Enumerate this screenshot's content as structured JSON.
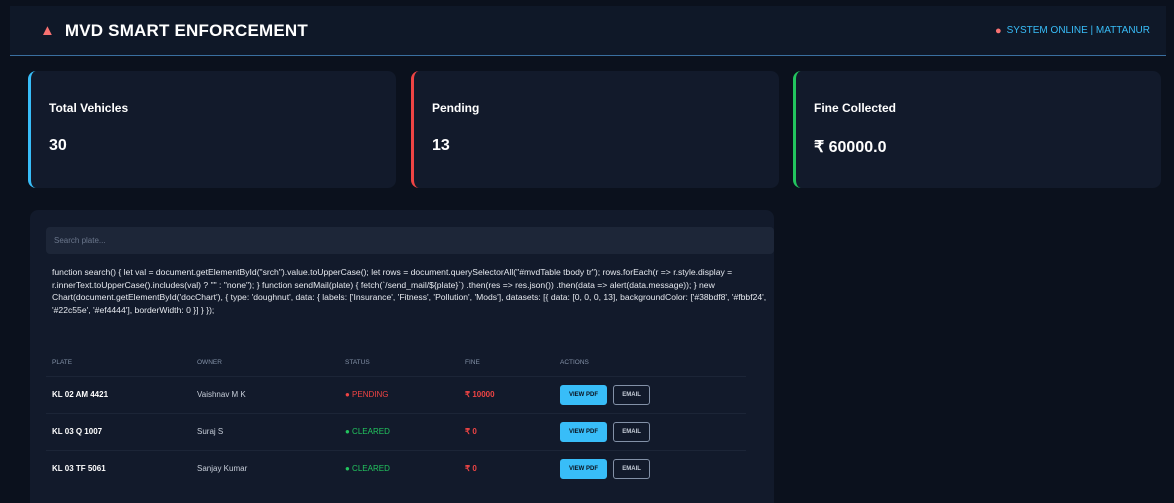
{
  "header": {
    "icon": "siren-icon",
    "title": "MVD SMART ENFORCEMENT",
    "status_icon": "pin-icon",
    "status_text": "SYSTEM ONLINE | MATTANUR"
  },
  "cards": [
    {
      "label": "Total Vehicles",
      "value": "30",
      "accent": "#38bdf8"
    },
    {
      "label": "Pending",
      "value": "13",
      "accent": "#ef4444"
    },
    {
      "label": "Fine Collected",
      "value": "₹ 60000.0",
      "accent": "#22c55e"
    }
  ],
  "search": {
    "placeholder": "Search plate..."
  },
  "script_text": "function search() { let val = document.getElementById(\"srch\").value.toUpperCase(); let rows = document.querySelectorAll(\"#mvdTable tbody tr\"); rows.forEach(r => r.style.display = r.innerText.toUpperCase().includes(val) ? \"\" : \"none\"); } function sendMail(plate) { fetch(`/send_mail/${plate}`) .then(res => res.json()) .then(data => alert(data.message)); } new Chart(document.getElementById('docChart'), { type: 'doughnut', data: { labels: ['Insurance', 'Fitness', 'Pollution', 'Mods'], datasets: [{ data: [0, 0, 0, 13], backgroundColor: ['#38bdf8', '#fbbf24', '#22c55e', '#ef4444'], borderWidth: 0 }] } });",
  "table": {
    "headers": {
      "plate": "PLATE",
      "owner": "OWNER",
      "status": "STATUS",
      "fine": "FINE",
      "actions": "ACTIONS"
    },
    "rows": [
      {
        "plate": "KL 02 AM 4421",
        "owner": "Vaishnav M K",
        "status": "● PENDING",
        "fine": "₹ 10000"
      },
      {
        "plate": "KL 03 Q 1007",
        "owner": "Suraj S",
        "status": "● CLEARED",
        "fine": "₹ 0"
      },
      {
        "plate": "KL 03 TF 5061",
        "owner": "Sanjay Kumar",
        "status": "● CLEARED",
        "fine": "₹ 0"
      }
    ],
    "view_pdf_label": "VIEW PDF",
    "email_label": "EMAIL"
  },
  "colors": {
    "accent": "#38bdf8",
    "danger": "#ef4444",
    "success": "#22c55e",
    "background": "#0b111d",
    "panel": "#121a2b"
  }
}
